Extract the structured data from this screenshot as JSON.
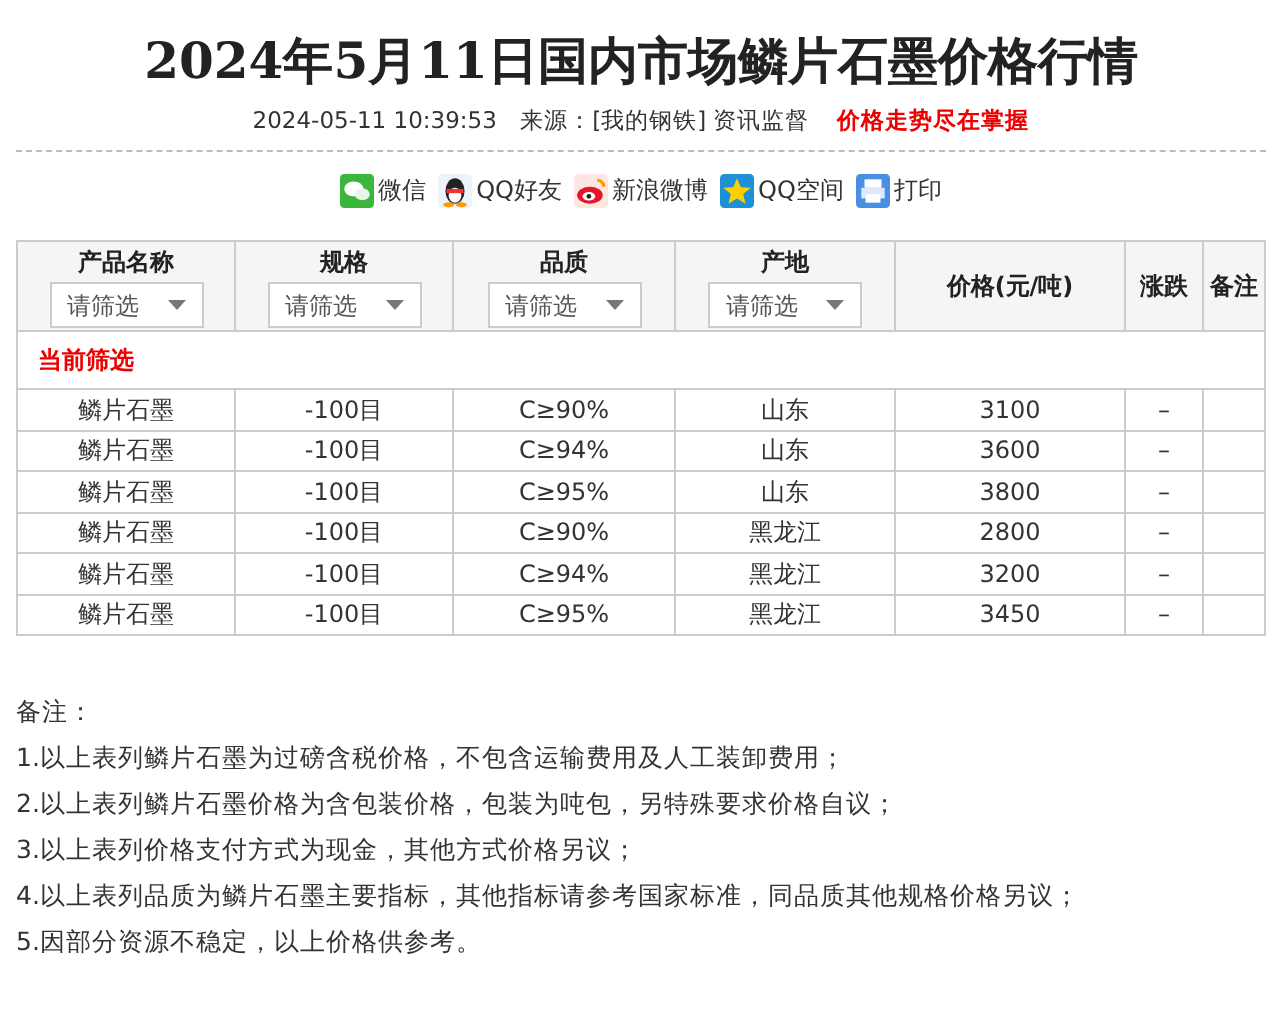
{
  "title": "2024年5月11日国内市场鳞片石墨价格行情",
  "meta": {
    "datetime": "2024-05-11 10:39:53",
    "source": "来源：[我的钢铁] 资讯监督",
    "slogan": "价格走势尽在掌握"
  },
  "share": [
    {
      "kind": "wechat",
      "label": "微信"
    },
    {
      "kind": "qq",
      "label": "QQ好友"
    },
    {
      "kind": "weibo",
      "label": "新浪微博"
    },
    {
      "kind": "qzone",
      "label": "QQ空间"
    },
    {
      "kind": "print",
      "label": "打印"
    }
  ],
  "table": {
    "columns": [
      {
        "label": "产品名称",
        "filter": "请筛选"
      },
      {
        "label": "规格",
        "filter": "请筛选"
      },
      {
        "label": "品质",
        "filter": "请筛选"
      },
      {
        "label": "产地",
        "filter": "请筛选"
      },
      {
        "label": "价格(元/吨)"
      },
      {
        "label": "涨跌"
      },
      {
        "label": "备注"
      }
    ],
    "filter_label": "当前筛选",
    "rows": [
      [
        "鳞片石墨",
        "-100目",
        "C≥90%",
        "山东",
        "3100",
        "–",
        ""
      ],
      [
        "鳞片石墨",
        "-100目",
        "C≥94%",
        "山东",
        "3600",
        "–",
        ""
      ],
      [
        "鳞片石墨",
        "-100目",
        "C≥95%",
        "山东",
        "3800",
        "–",
        ""
      ],
      [
        "鳞片石墨",
        "-100目",
        "C≥90%",
        "黑龙江",
        "2800",
        "–",
        ""
      ],
      [
        "鳞片石墨",
        "-100目",
        "C≥94%",
        "黑龙江",
        "3200",
        "–",
        ""
      ],
      [
        "鳞片石墨",
        "-100目",
        "C≥95%",
        "黑龙江",
        "3450",
        "–",
        ""
      ]
    ]
  },
  "notes": {
    "heading": "备注：",
    "items": [
      "1.以上表列鳞片石墨为过磅含税价格，不包含运输费用及人工装卸费用；",
      "2.以上表列鳞片石墨价格为含包装价格，包装为吨包，另特殊要求价格自议；",
      "3.以上表列价格支付方式为现金，其他方式价格另议；",
      "4.以上表列品质为鳞片石墨主要指标，其他指标请参考国家标准，同品质其他规格价格另议；",
      "5.因部分资源不稳定，以上价格供参考。"
    ]
  }
}
